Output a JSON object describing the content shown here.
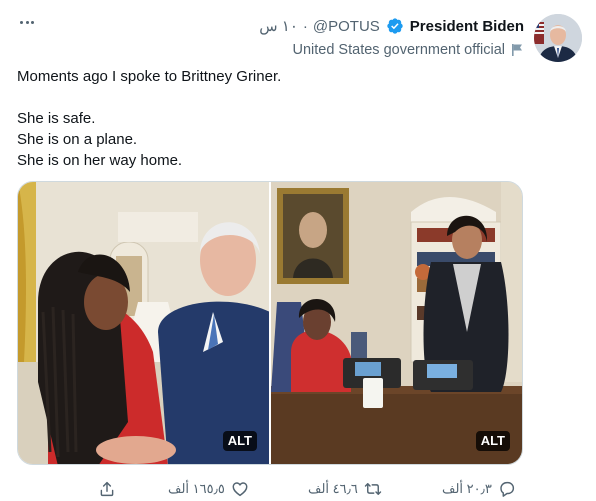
{
  "header": {
    "display_name": "President Biden",
    "handle": "@POTUS",
    "separator": "·",
    "time": "١٠ س",
    "affiliation": "United States government official"
  },
  "tweet": {
    "lines": [
      "Moments ago I spoke to Brittney Griner.",
      "",
      "She is safe.",
      "She is on a plane.",
      "She is on her way home."
    ]
  },
  "media": {
    "badges": [
      "ALT",
      "ALT"
    ]
  },
  "actions": {
    "reply_count": "٢٠٫٣ ألف",
    "retweet_count": "٤٦٫٦ ألف",
    "like_count": "١٦٥٫٥ ألف"
  },
  "colors": {
    "text_primary": "#0f1419",
    "text_secondary": "#536471",
    "verified": "#1d9bf0",
    "border": "#cfd9de"
  },
  "icons": [
    "more-icon",
    "verified-badge-icon",
    "affiliation-flag-icon",
    "reply-icon",
    "retweet-icon",
    "like-icon",
    "share-icon"
  ]
}
